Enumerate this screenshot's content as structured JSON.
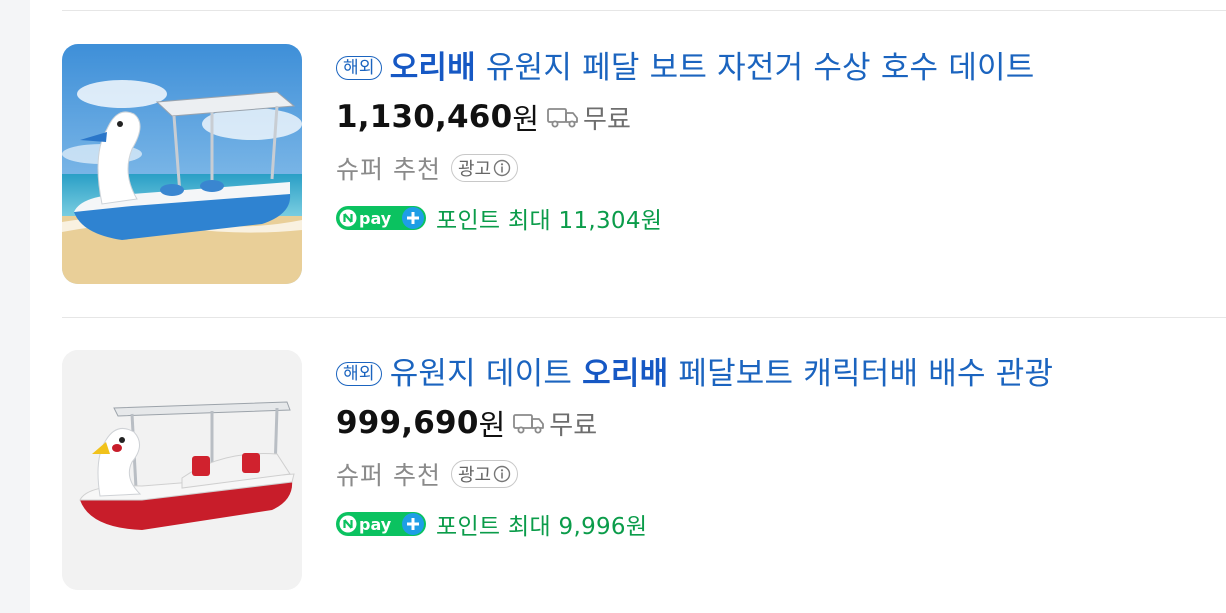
{
  "products": [
    {
      "badge": "해외",
      "title_keyword": "오리배",
      "title_rest": "유원지 페달 보트 자전거 수상 호수 데이트",
      "price": "1,130,460",
      "currency": "원",
      "shipping": "무료",
      "super_label": "슈퍼 추천",
      "ad_label": "광고",
      "pay_text": "pay",
      "points": "포인트 최대 11,304원",
      "image_icon": "swan-pedal-boat-blue"
    },
    {
      "badge": "해외",
      "title_prefix": "유원지 데이트",
      "title_keyword": "오리배",
      "title_suffix": "페달보트 캐릭터배 배수 관광",
      "price": "999,690",
      "currency": "원",
      "shipping": "무료",
      "super_label": "슈퍼 추천",
      "ad_label": "광고",
      "pay_text": "pay",
      "points": "포인트 최대 9,996원",
      "image_icon": "swan-pedal-boat-red"
    }
  ],
  "colors": {
    "title": "#1b64bf",
    "price": "#111111",
    "points": "#0b9c4a",
    "npay_green": "#0bc260",
    "npay_blue": "#1e9ee6"
  }
}
